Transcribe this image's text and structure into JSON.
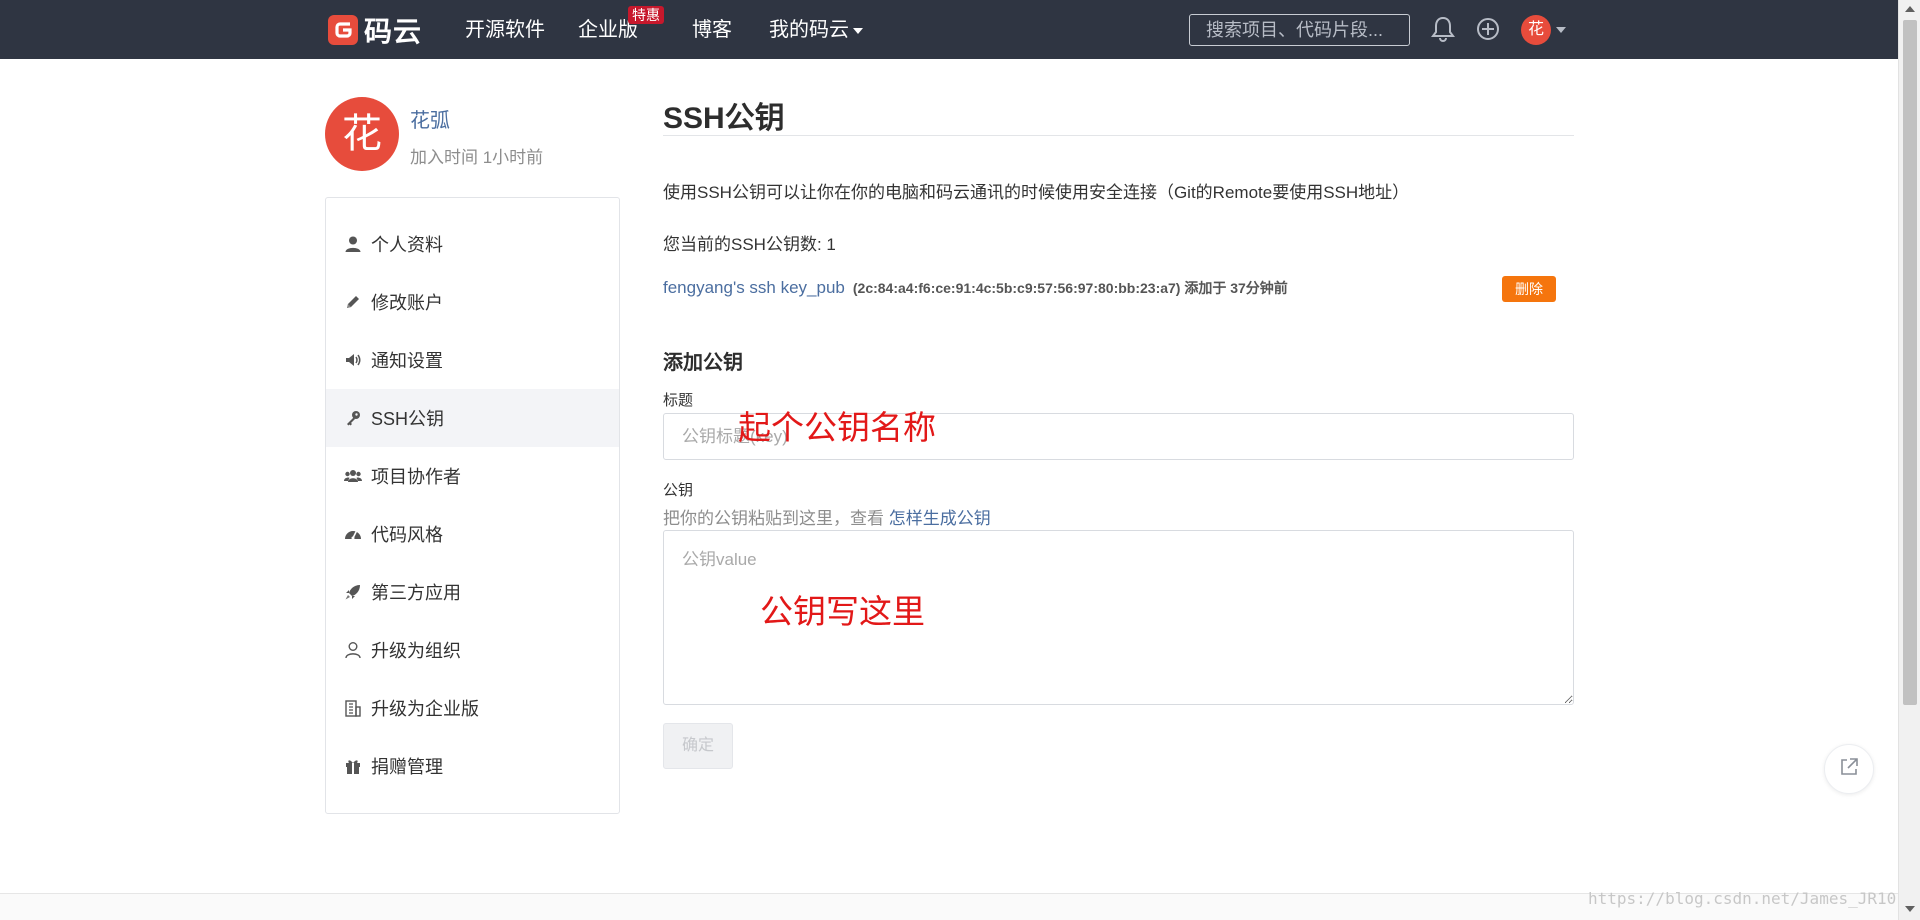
{
  "colors": {
    "topbar": "#2f3542",
    "brand_red": "#e74c3c",
    "link": "#4b6ea0",
    "delete": "#f5750d",
    "annotation": "#e21818"
  },
  "nav": {
    "logo_text": "码云",
    "items": [
      "开源软件",
      "企业版",
      "博客",
      "我的码云"
    ],
    "special_badge": "特惠",
    "search_placeholder": "搜索项目、代码片段...",
    "icons": [
      "bell-icon",
      "plus-circle-icon"
    ],
    "avatar_char": "花"
  },
  "profile": {
    "avatar_char": "花",
    "name": "花弧",
    "joined": "加入时间 1小时前"
  },
  "sidebar": {
    "items": [
      {
        "label": "个人资料",
        "icon": "user-icon"
      },
      {
        "label": "修改账户",
        "icon": "pencil-icon"
      },
      {
        "label": "通知设置",
        "icon": "speaker-icon"
      },
      {
        "label": "SSH公钥",
        "icon": "key-icon",
        "active": true
      },
      {
        "label": "项目协作者",
        "icon": "users-icon"
      },
      {
        "label": "代码风格",
        "icon": "dashboard-icon"
      },
      {
        "label": "第三方应用",
        "icon": "rocket-icon"
      },
      {
        "label": "升级为组织",
        "icon": "user-outline-icon"
      },
      {
        "label": "升级为企业版",
        "icon": "building-icon"
      },
      {
        "label": "捐赠管理",
        "icon": "gift-icon"
      }
    ]
  },
  "main": {
    "title": "SSH公钥",
    "description": "使用SSH公钥可以让你在你的电脑和码云通讯的时候使用安全连接（Git的Remote要使用SSH地址）",
    "count_text": "您当前的SSH公钥数: 1",
    "key": {
      "name": "fengyang's ssh key_pub",
      "meta": "(2c:84:a4:f6:ce:91:4c:5b:c9:57:56:97:80:bb:23:a7) 添加于 37分钟前",
      "delete_label": "删除"
    },
    "add_section_title": "添加公钥",
    "title_label": "标题",
    "title_placeholder": "公钥标题(key)",
    "key_label": "公钥",
    "hint_text": "把你的公钥粘贴到这里，查看 ",
    "hint_link": "怎样生成公钥",
    "key_placeholder": "公钥value",
    "submit_label": "确定"
  },
  "annotations": {
    "title_note": "起个公钥名称",
    "key_note": "公钥写这里"
  },
  "watermark": "https://blog.csdn.net/James_JR10"
}
